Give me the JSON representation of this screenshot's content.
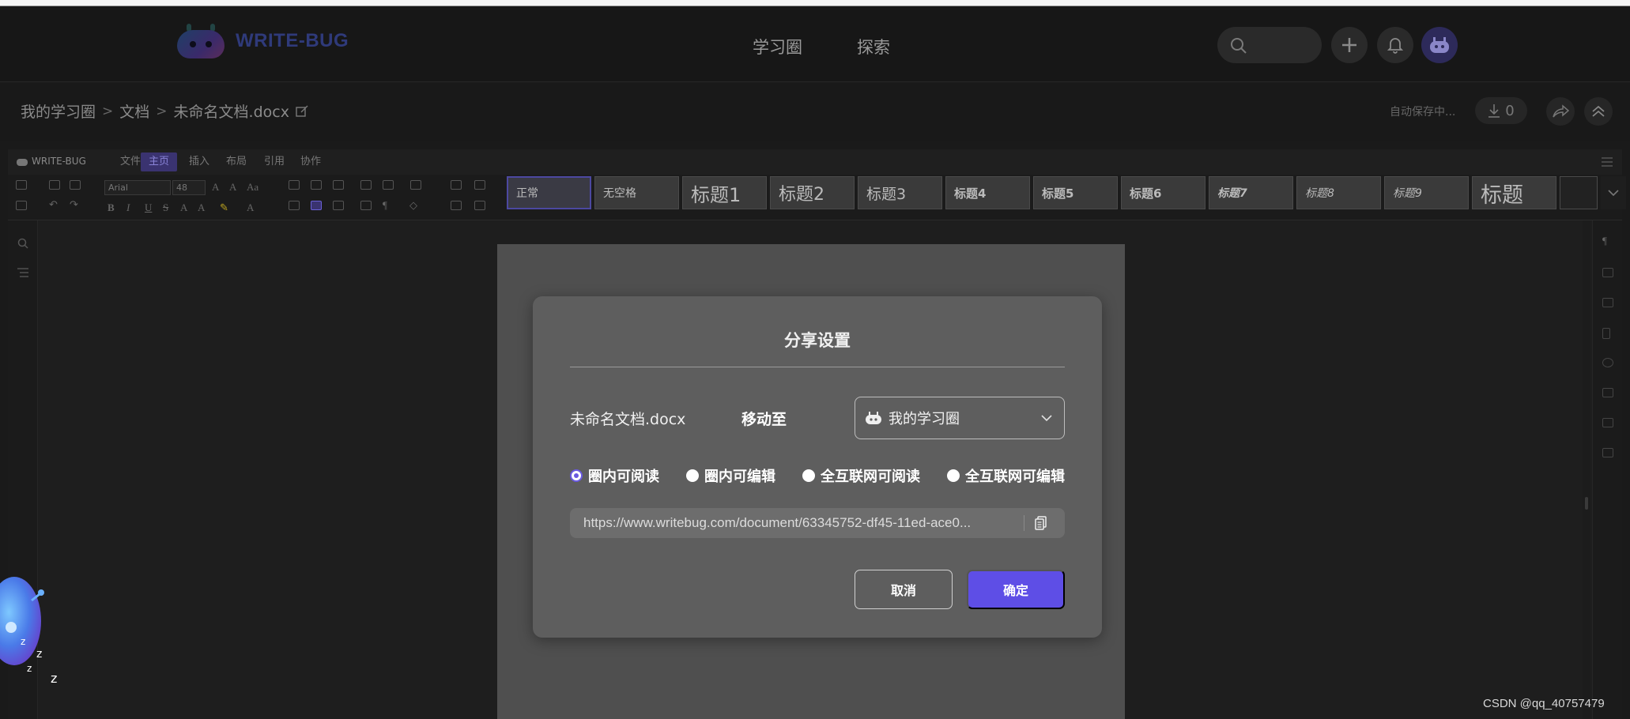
{
  "header": {
    "brand": "WRITE-BUG",
    "nav": [
      "学习圈",
      "探索"
    ],
    "search_icon": "search-icon",
    "add_icon": "plus-icon",
    "bell_icon": "bell-icon",
    "avatar_icon": "robot-avatar"
  },
  "breadcrumb": {
    "items": [
      "我的学习圈",
      "文档",
      "未命名文档.docx"
    ],
    "autosave": "自动保存中...",
    "download_count": "0"
  },
  "editor": {
    "brand": "WRITE-BUG",
    "menus": [
      "文件",
      "主页",
      "插入",
      "布局",
      "引用",
      "协作"
    ],
    "active_menu": "主页",
    "font_name": "Arial",
    "font_size": "48",
    "styles": [
      "正常",
      "无空格",
      "标题1",
      "标题2",
      "标题3",
      "标题4",
      "标题5",
      "标题6",
      "标题7",
      "标题8",
      "标题9",
      "标题"
    ]
  },
  "modal": {
    "title": "分享设置",
    "doc_name": "未命名文档.docx",
    "move_label": "移动至",
    "move_value": "我的学习圈",
    "radios": [
      "圈内可阅读",
      "圈内可编辑",
      "全互联网可阅读",
      "全互联网可编辑"
    ],
    "selected_radio": "圈内可阅读",
    "link": "https://www.writebug.com/document/63345752-df45-11ed-ace0...",
    "cancel": "取消",
    "ok": "确定"
  },
  "colors": {
    "accent": "#5e4ee6",
    "modal_bg": "#5e5e5e"
  },
  "watermark": "CSDN @qq_40757479"
}
